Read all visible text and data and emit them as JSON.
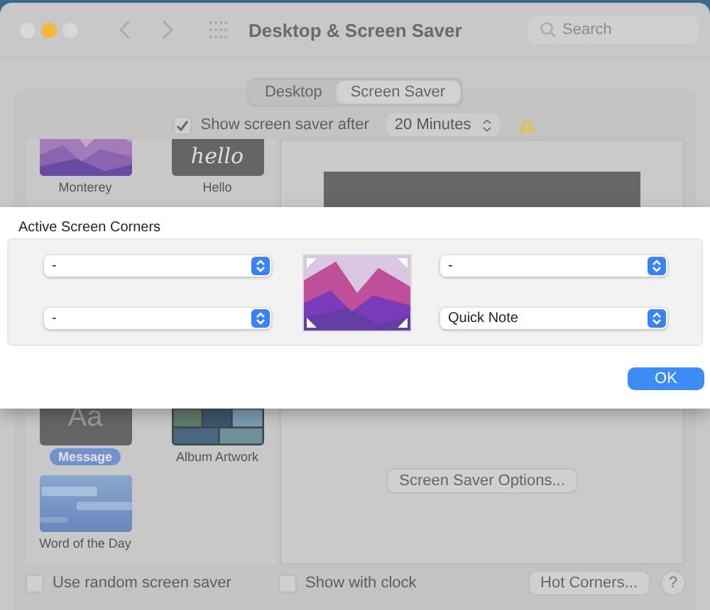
{
  "window": {
    "title": "Desktop & Screen Saver"
  },
  "search": {
    "placeholder": "Search"
  },
  "tabs": [
    {
      "label": "Desktop",
      "selected": false
    },
    {
      "label": "Screen Saver",
      "selected": true
    }
  ],
  "show_after": {
    "label": "Show screen saver after",
    "checked": true,
    "value": "20 Minutes"
  },
  "savers": [
    {
      "label": "Monterey",
      "kind": "landscape",
      "selected": false
    },
    {
      "label": "Hello",
      "kind": "hello",
      "preview": "hello",
      "selected": false
    },
    {
      "label": "Message",
      "kind": "message",
      "preview": "Aa",
      "selected": true
    },
    {
      "label": "Album Artwork",
      "kind": "mosaic",
      "selected": false
    },
    {
      "label": "Word of the Day",
      "kind": "words",
      "selected": false
    }
  ],
  "options_button": "Screen Saver Options...",
  "random": {
    "label": "Use random screen saver",
    "checked": false
  },
  "clock": {
    "label": "Show with clock",
    "checked": false
  },
  "hot_corners_button": "Hot Corners...",
  "help_button": "?",
  "sheet": {
    "title": "Active Screen Corners",
    "corners": [
      {
        "value": "-"
      },
      {
        "value": "-"
      },
      {
        "value": "-"
      },
      {
        "value": "Quick Note"
      }
    ],
    "ok_button": "OK"
  }
}
